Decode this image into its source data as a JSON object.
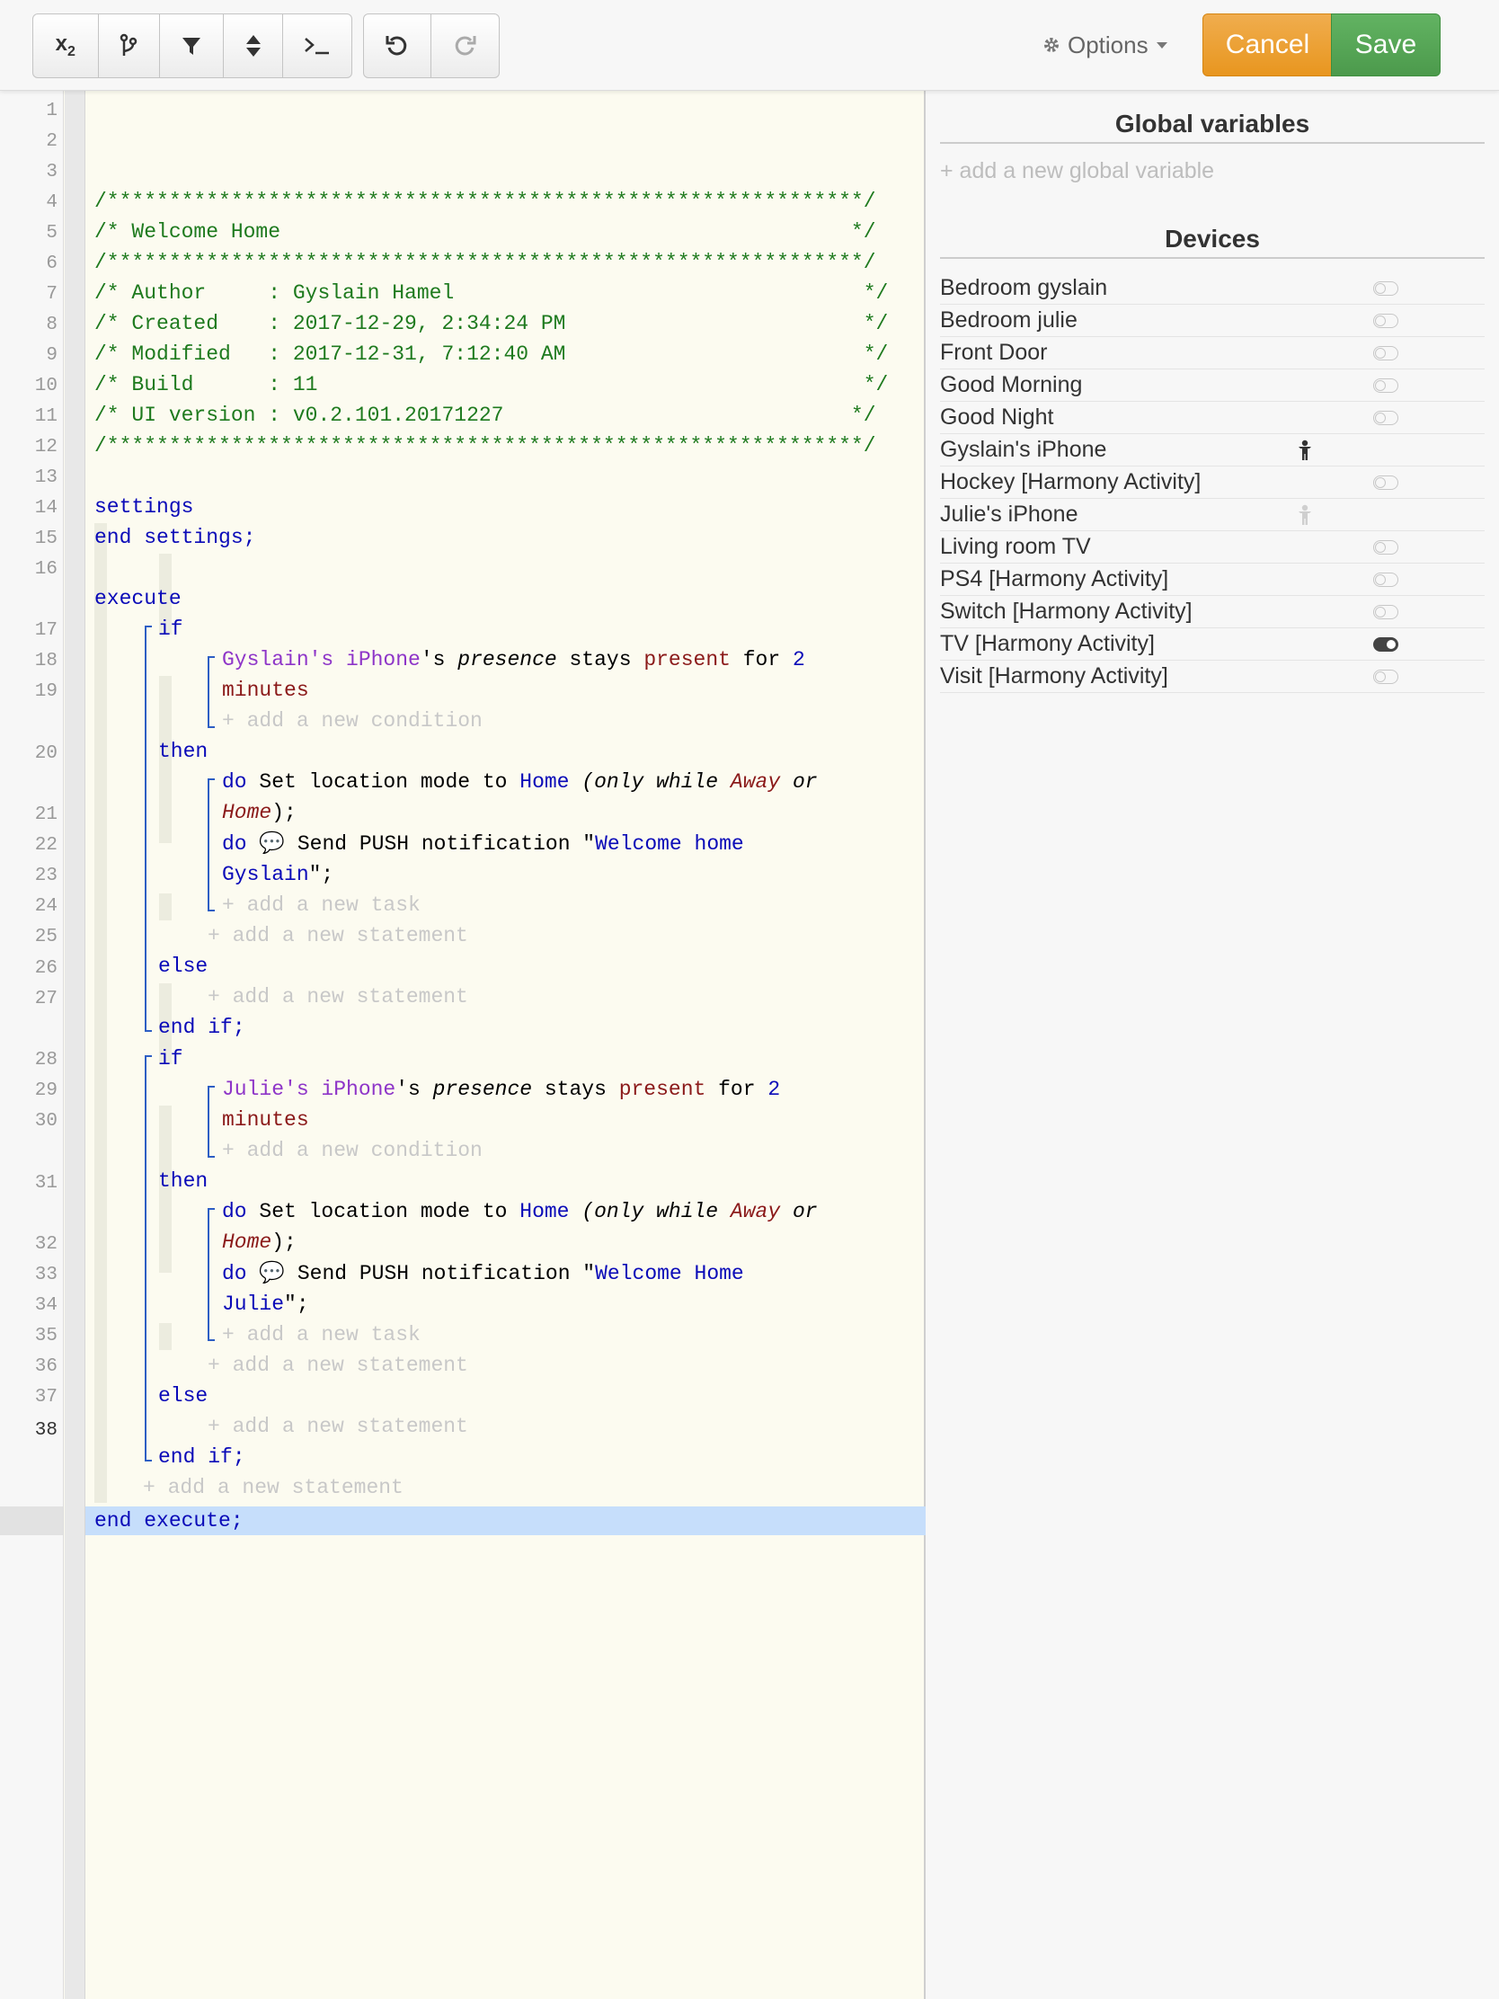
{
  "toolbar": {
    "buttons": [
      "x₂",
      "branch",
      "filter",
      "sort",
      ">_",
      "undo",
      "redo"
    ],
    "options_label": "Options",
    "cancel_label": "Cancel",
    "save_label": "Save",
    "icons": [
      "subscript-icon",
      "branch-icon",
      "filter-icon",
      "sort-icon",
      "terminal-icon",
      "undo-icon",
      "redo-icon",
      "gear-icon",
      "caret-down-icon"
    ]
  },
  "code": {
    "line_numbers": [
      "1",
      "2",
      "3",
      "4",
      "5",
      "6",
      "7",
      "8",
      "9",
      "10",
      "11",
      "12",
      "13",
      "14",
      "15",
      "16",
      "17",
      "18",
      "19",
      "20",
      "21",
      "22",
      "23",
      "24",
      "25",
      "26",
      "27",
      "28",
      "29",
      "30",
      "31",
      "32",
      "33",
      "34",
      "35",
      "36",
      "37",
      "38"
    ],
    "current_line": "38",
    "header": {
      "border": "/*************************************************************/",
      "title": "/* Welcome Home                                              */",
      "author": "/* Author     : Gyslain Hamel                                 */",
      "created": "/* Created    : 2017-12-29, 2:34:24 PM                        */",
      "modified": "/* Modified   : 2017-12-31, 7:12:40 AM                        */",
      "build": "/* Build      : 11                                            */",
      "ui_version": "/* UI version : v0.2.101.20171227                            */"
    },
    "kw": {
      "settings": "settings",
      "end_settings": "end settings;",
      "execute": "execute",
      "if": "if",
      "then": "then",
      "else": "else",
      "end_if": "end if;",
      "end_execute": "end execute;",
      "do": "do"
    },
    "phrases": {
      "possessive": "'s ",
      "presence": "presence",
      "stays": " stays ",
      "present": "present",
      "for": " for ",
      "two": "2",
      "minutes": "minutes",
      "set_mode": " Set location mode to ",
      "home": "Home",
      "only_while": " (only while ",
      "away": "Away",
      "or": " or",
      "close_paren": ");",
      "send_push": " 💬 Send PUSH notification \"",
      "quote_end": "\";"
    },
    "devices_in_code": {
      "gyslain": "Gyslain's iPhone",
      "julie": "Julie's iPhone"
    },
    "messages": {
      "msg1_a": "Welcome home",
      "msg1_b": "Gyslain",
      "msg2_a": "Welcome Home",
      "msg2_b": "Julie"
    },
    "add": {
      "condition": "+ add a new condition",
      "task": "+ add a new task",
      "statement": "+ add a new statement"
    }
  },
  "sidebar": {
    "global_title": "Global variables",
    "add_global": "+ add a new global variable",
    "devices_title": "Devices",
    "devices": [
      {
        "name": "Bedroom gyslain",
        "kind": "toggle",
        "state": "off"
      },
      {
        "name": "Bedroom julie",
        "kind": "toggle",
        "state": "off"
      },
      {
        "name": "Front Door",
        "kind": "toggle",
        "state": "off"
      },
      {
        "name": "Good Morning",
        "kind": "toggle",
        "state": "off"
      },
      {
        "name": "Good Night",
        "kind": "toggle",
        "state": "off"
      },
      {
        "name": "Gyslain's iPhone",
        "kind": "presence",
        "state": "present"
      },
      {
        "name": "Hockey [Harmony Activity]",
        "kind": "toggle",
        "state": "off"
      },
      {
        "name": "Julie's iPhone",
        "kind": "presence",
        "state": "not present"
      },
      {
        "name": "Living room TV",
        "kind": "toggle",
        "state": "off"
      },
      {
        "name": "PS4 [Harmony Activity]",
        "kind": "toggle",
        "state": "off"
      },
      {
        "name": "Switch [Harmony Activity]",
        "kind": "toggle",
        "state": "off"
      },
      {
        "name": "TV [Harmony Activity]",
        "kind": "toggle",
        "state": "on"
      },
      {
        "name": "Visit [Harmony Activity]",
        "kind": "toggle",
        "state": "off"
      }
    ]
  },
  "colors": {
    "comment": "#1e7a1e",
    "keyword": "#0a0ab8",
    "device": "#8e35c8",
    "value": "#8b1a1a",
    "cancel": "#f0ad4e",
    "save": "#5cb85c",
    "highlight": "#c6defb"
  }
}
